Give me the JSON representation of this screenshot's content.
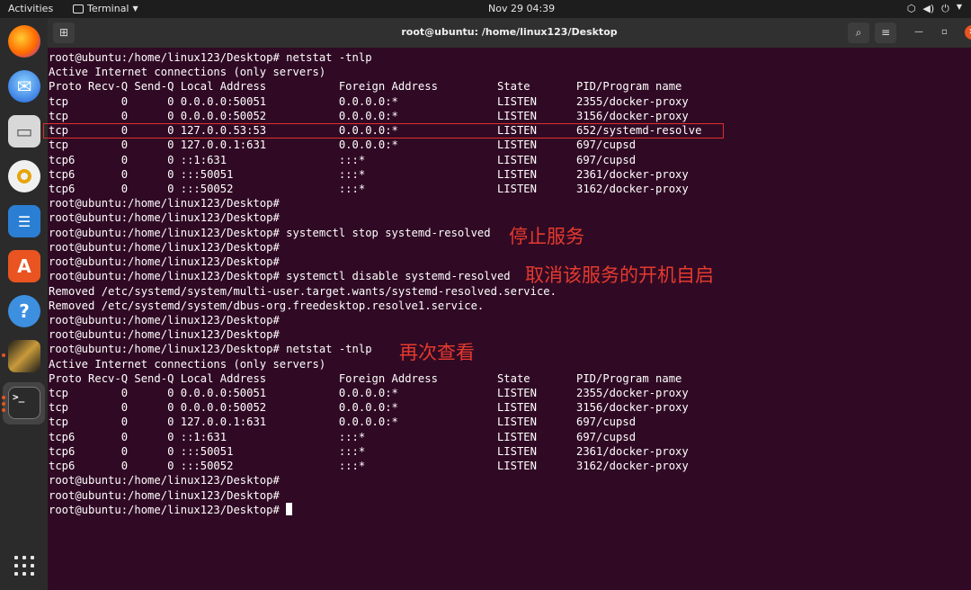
{
  "topbar": {
    "activities": "Activities",
    "app_name": "Terminal",
    "clock": "Nov 29  04:39",
    "tray_icons": [
      "network-icon",
      "volume-icon",
      "power-icon"
    ]
  },
  "dock": {
    "apps": [
      "firefox",
      "thunderbird",
      "files",
      "rhythmbox",
      "libreoffice-writer",
      "ubuntu-software",
      "help",
      "user-app",
      "terminal"
    ]
  },
  "window": {
    "title": "root@ubuntu: /home/linux123/Desktop"
  },
  "terminal": {
    "lines": [
      "root@ubuntu:/home/linux123/Desktop# netstat -tnlp",
      "Active Internet connections (only servers)",
      "Proto Recv-Q Send-Q Local Address           Foreign Address         State       PID/Program name",
      "tcp        0      0 0.0.0.0:50051           0.0.0.0:*               LISTEN      2355/docker-proxy",
      "tcp        0      0 0.0.0.0:50052           0.0.0.0:*               LISTEN      3156/docker-proxy",
      "tcp        0      0 127.0.0.53:53           0.0.0.0:*               LISTEN      652/systemd-resolve",
      "tcp        0      0 127.0.0.1:631           0.0.0.0:*               LISTEN      697/cupsd",
      "tcp6       0      0 ::1:631                 :::*                    LISTEN      697/cupsd",
      "tcp6       0      0 :::50051                :::*                    LISTEN      2361/docker-proxy",
      "tcp6       0      0 :::50052                :::*                    LISTEN      3162/docker-proxy",
      "root@ubuntu:/home/linux123/Desktop#",
      "root@ubuntu:/home/linux123/Desktop#",
      "root@ubuntu:/home/linux123/Desktop# systemctl stop systemd-resolved",
      "root@ubuntu:/home/linux123/Desktop#",
      "root@ubuntu:/home/linux123/Desktop#",
      "root@ubuntu:/home/linux123/Desktop# systemctl disable systemd-resolved",
      "Removed /etc/systemd/system/multi-user.target.wants/systemd-resolved.service.",
      "Removed /etc/systemd/system/dbus-org.freedesktop.resolve1.service.",
      "root@ubuntu:/home/linux123/Desktop#",
      "root@ubuntu:/home/linux123/Desktop#",
      "root@ubuntu:/home/linux123/Desktop# netstat -tnlp",
      "Active Internet connections (only servers)",
      "Proto Recv-Q Send-Q Local Address           Foreign Address         State       PID/Program name",
      "tcp        0      0 0.0.0.0:50051           0.0.0.0:*               LISTEN      2355/docker-proxy",
      "tcp        0      0 0.0.0.0:50052           0.0.0.0:*               LISTEN      3156/docker-proxy",
      "tcp        0      0 127.0.0.1:631           0.0.0.0:*               LISTEN      697/cupsd",
      "tcp6       0      0 ::1:631                 :::*                    LISTEN      697/cupsd",
      "tcp6       0      0 :::50051                :::*                    LISTEN      2361/docker-proxy",
      "tcp6       0      0 :::50052                :::*                    LISTEN      3162/docker-proxy",
      "root@ubuntu:/home/linux123/Desktop#",
      "root@ubuntu:/home/linux123/Desktop#",
      "root@ubuntu:/home/linux123/Desktop#"
    ]
  },
  "annotations": {
    "stop_service": "停止服务",
    "disable_autostart": "取消该服务的开机自启",
    "check_again": "再次查看"
  },
  "colors": {
    "terminal_bg": "#300a24",
    "annotation": "#e53a2e",
    "accent": "#e95420"
  }
}
